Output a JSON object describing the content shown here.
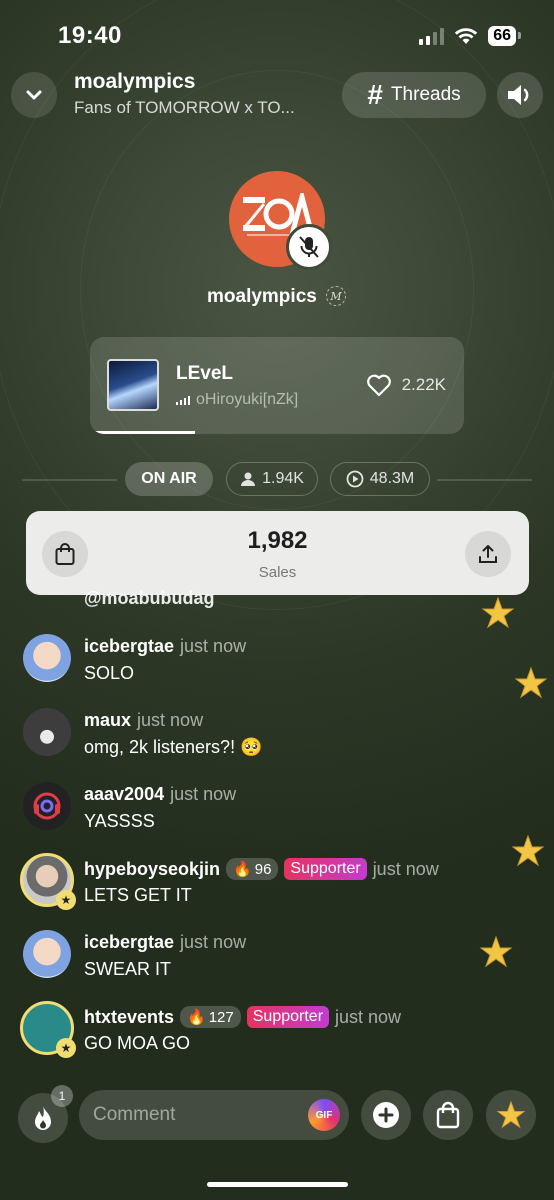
{
  "status_bar": {
    "time": "19:40",
    "battery": "66"
  },
  "header": {
    "title": "moalympics",
    "subtitle": "Fans of TOMORROW x TO...",
    "threads_label": "Threads"
  },
  "host": {
    "name": "moalympics",
    "logo_text": "OA"
  },
  "music": {
    "title": "LEveL",
    "artist": "oHiroyuki[nZk]",
    "likes": "2.22K",
    "progress": 0.28
  },
  "stats": {
    "status": "ON AIR",
    "listeners": "1.94K",
    "plays": "48.3M"
  },
  "sales": {
    "count": "1,982",
    "label": "Sales"
  },
  "chat": {
    "partial_username": "@moabubudag",
    "messages": [
      {
        "user": "icebergtae",
        "time": "just now",
        "text": "SOLO"
      },
      {
        "user": "maux",
        "time": "just now",
        "text": "omg, 2k listeners?! 🥺"
      },
      {
        "user": "aaav2004",
        "time": "just now",
        "text": "YASSSS"
      },
      {
        "user": "hypeboyseokjin",
        "fire": "96",
        "badge": "Supporter",
        "time": "just now",
        "text": "LETS GET IT"
      },
      {
        "user": "icebergtae",
        "time": "just now",
        "text": "SWEAR IT"
      },
      {
        "user": "htxtevents",
        "fire": "127",
        "badge": "Supporter",
        "time": "just now",
        "text": "GO MOA GO"
      }
    ]
  },
  "bottom": {
    "fire_count": "1",
    "comment_placeholder": "Comment",
    "gif_label": "GIF"
  },
  "colors": {
    "background": "#26311f",
    "host_avatar": "#e1623c",
    "supporter_start": "#e5335f",
    "supporter_end": "#c43bd1",
    "gold_ring": "#f1dd72"
  }
}
